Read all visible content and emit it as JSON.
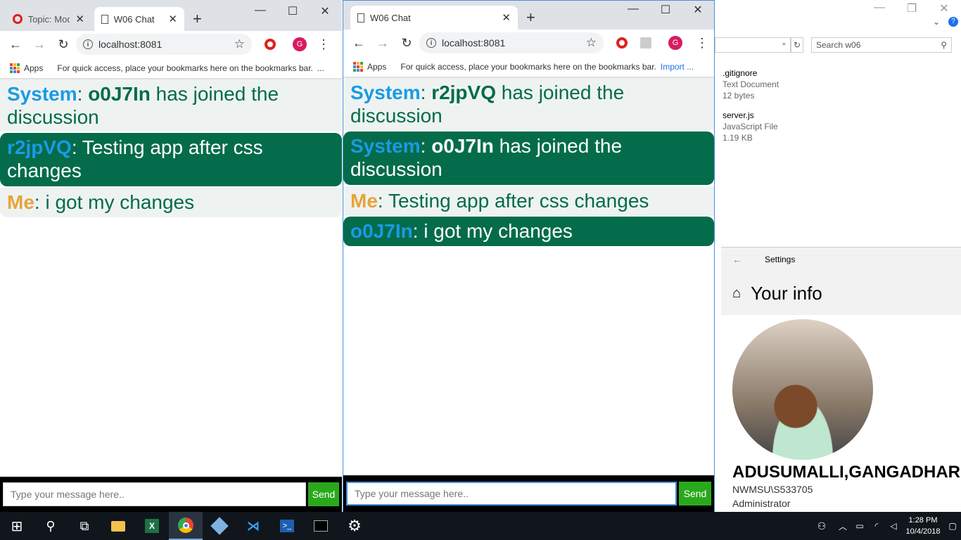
{
  "left_window": {
    "tabs": [
      {
        "label": "Topic: Modu",
        "active": false
      },
      {
        "label": "W06 Chat",
        "active": true
      }
    ],
    "url": "localhost:8081",
    "bookmarks": {
      "apps": "Apps",
      "hint": "For quick access, place your bookmarks here on the bookmarks bar."
    },
    "messages": [
      {
        "user": "System",
        "bold": "o0J7In",
        "text": " has joined the discussion",
        "style": "light"
      },
      {
        "user": "r2jpVQ",
        "text": ": Testing app after css changes",
        "style": "dark"
      },
      {
        "user": "Me",
        "text": ": i got my changes",
        "style": "light"
      }
    ],
    "input_placeholder": "Type your message here..",
    "send_label": "Send"
  },
  "right_window": {
    "tab": "W06 Chat",
    "url": "localhost:8081",
    "bookmarks": {
      "apps": "Apps",
      "hint": "For quick access, place your bookmarks here on the bookmarks bar.",
      "import": "Import ..."
    },
    "messages": [
      {
        "user": "System",
        "bold": "r2jpVQ",
        "text": " has joined the discussion",
        "style": "light"
      },
      {
        "user": "System",
        "bold": "o0J7In",
        "text": " has joined the discussion",
        "style": "dark"
      },
      {
        "user": "Me",
        "text": ": Testing app after css changes",
        "style": "light"
      },
      {
        "user": "o0J7In",
        "text": ": i got my changes",
        "style": "dark"
      }
    ],
    "input_placeholder": "Type your message here..",
    "send_label": "Send"
  },
  "explorer": {
    "search_placeholder": "Search w06",
    "files": [
      {
        "name": ".gitignore",
        "type": "Text Document",
        "size": "12 bytes"
      },
      {
        "name": "server.js",
        "type": "JavaScript File",
        "size": "1.19 KB"
      }
    ]
  },
  "settings": {
    "title": "Settings",
    "heading": "Your info",
    "name": "ADUSUMALLI,GANGADHAR",
    "account": "NWMSU\\S533705",
    "role": "Administrator"
  },
  "taskbar": {
    "time": "1:28 PM",
    "date": "10/4/2018"
  }
}
